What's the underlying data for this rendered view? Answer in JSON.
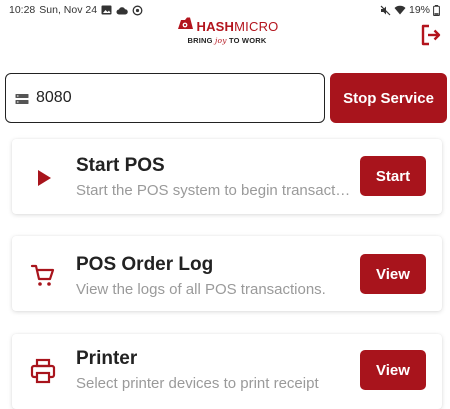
{
  "status_bar": {
    "time": "10:28",
    "date": "Sun, Nov 24",
    "battery": "19%",
    "icons_left": [
      "image-icon",
      "cloud-icon",
      "sync-icon"
    ],
    "icons_right": [
      "mute-icon",
      "wifi-icon",
      "battery-icon"
    ]
  },
  "header": {
    "brand_bold": "HASH",
    "brand_thin": "MICRO",
    "tagline_before": "BRING",
    "tagline_joy": "joy",
    "tagline_after": "TO WORK",
    "logout_icon": "logout-icon"
  },
  "service": {
    "port_value": "8080",
    "port_icon": "server-icon",
    "stop_label": "Stop Service"
  },
  "cards": [
    {
      "icon": "play-icon",
      "title": "Start POS",
      "description": "Start the POS system to begin transacti…",
      "button": "Start"
    },
    {
      "icon": "cart-icon",
      "title": "POS Order Log",
      "description": "View the logs of all POS transactions.",
      "button": "View"
    },
    {
      "icon": "printer-icon",
      "title": "Printer",
      "description": "Select printer devices to print receipt",
      "button": "View"
    }
  ],
  "colors": {
    "accent": "#a8141c",
    "text": "#222222",
    "muted": "#9a9a9a"
  }
}
